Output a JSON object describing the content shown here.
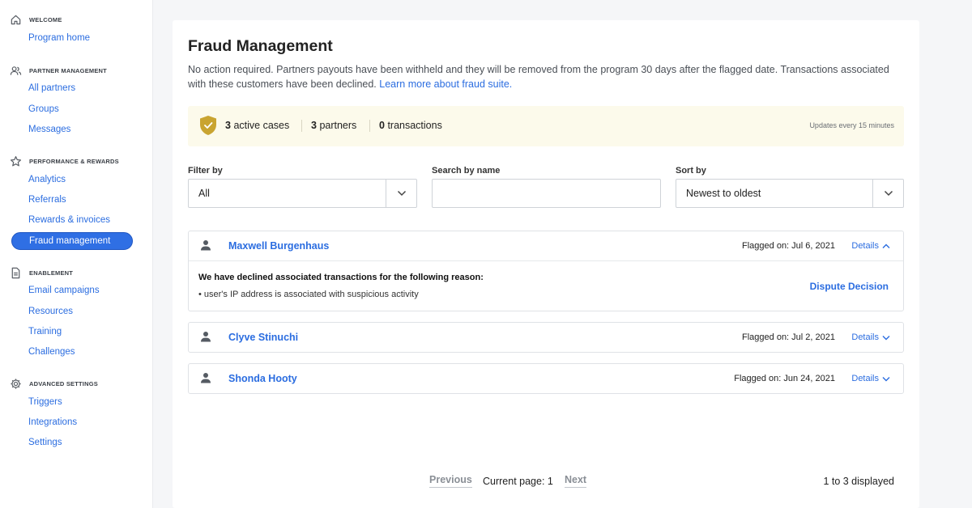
{
  "sidebar": {
    "sections": [
      {
        "title": "WELCOME",
        "icon": "home-icon",
        "items": [
          "Program home"
        ]
      },
      {
        "title": "PARTNER MANAGEMENT",
        "icon": "users-icon",
        "items": [
          "All partners",
          "Groups",
          "Messages"
        ]
      },
      {
        "title": "PERFORMANCE & REWARDS",
        "icon": "star-icon",
        "items": [
          "Analytics",
          "Referrals",
          "Rewards & invoices",
          "Fraud management"
        ]
      },
      {
        "title": "ENABLEMENT",
        "icon": "document-icon",
        "items": [
          "Email campaigns",
          "Resources",
          "Training",
          "Challenges"
        ]
      },
      {
        "title": "ADVANCED SETTINGS",
        "icon": "gear-icon",
        "items": [
          "Triggers",
          "Integrations",
          "Settings"
        ]
      }
    ],
    "active_item": "Fraud management"
  },
  "page": {
    "title": "Fraud Management",
    "description": "No action required. Partners payouts have been withheld and they will be removed from the program 30 days after the flagged date. Transactions associated with these customers have been declined.",
    "learn_more": "Learn more about fraud suite."
  },
  "banner": {
    "icon": "shield-check-icon",
    "active_cases_count": "3",
    "active_cases_label": "active cases",
    "partners_count": "3",
    "partners_label": "partners",
    "transactions_count": "0",
    "transactions_label": "transactions",
    "updates_note": "Updates every 15 minutes"
  },
  "filters": {
    "filter_label": "Filter by",
    "filter_value": "All",
    "search_label": "Search by name",
    "search_value": "",
    "sort_label": "Sort by",
    "sort_value": "Newest to oldest"
  },
  "cases": [
    {
      "name": "Maxwell Burgenhaus",
      "flagged": "Flagged on: Jul 6, 2021",
      "details_label": "Details",
      "expanded": true,
      "reason_title": "We have declined associated transactions for the following reason:",
      "reason": "• user's IP address is associated with suspicious activity",
      "dispute_label": "Dispute Decision"
    },
    {
      "name": "Clyve Stinuchi",
      "flagged": "Flagged on: Jul 2, 2021",
      "details_label": "Details",
      "expanded": false
    },
    {
      "name": "Shonda Hooty",
      "flagged": "Flagged on: Jun 24, 2021",
      "details_label": "Details",
      "expanded": false
    }
  ],
  "pagination": {
    "previous": "Previous",
    "current": "Current page: 1",
    "next": "Next",
    "count": "1 to 3 displayed"
  },
  "colors": {
    "accent": "#2f6fe4",
    "link": "#2b6de0",
    "banner_bg": "#fcfaeb",
    "shield": "#c9a431"
  }
}
